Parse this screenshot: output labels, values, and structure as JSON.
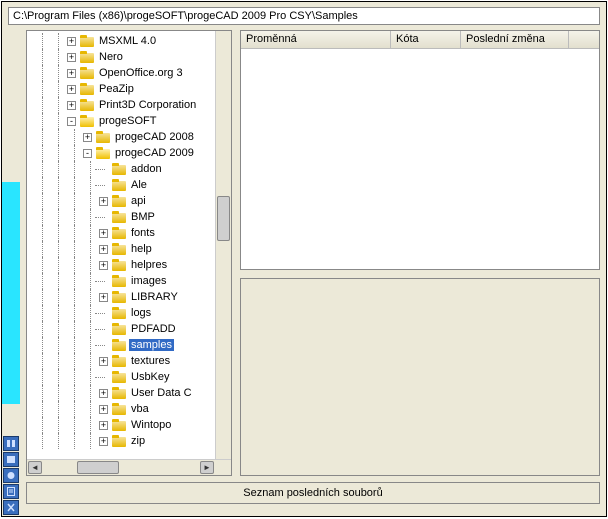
{
  "path": "C:\\Program Files (x86)\\progeSOFT\\progeCAD 2009 Pro CSY\\Samples",
  "tree": [
    {
      "depth": 6,
      "exp": "+",
      "label": "MSXML 4.0"
    },
    {
      "depth": 6,
      "exp": "+",
      "label": "Nero"
    },
    {
      "depth": 6,
      "exp": "+",
      "label": "OpenOffice.org 3"
    },
    {
      "depth": 6,
      "exp": "+",
      "label": "PeaZip"
    },
    {
      "depth": 6,
      "exp": "+",
      "label": "Print3D Corporation"
    },
    {
      "depth": 6,
      "exp": "-",
      "label": "progeSOFT",
      "open": true
    },
    {
      "depth": 7,
      "exp": "+",
      "label": "progeCAD 2008"
    },
    {
      "depth": 7,
      "exp": "-",
      "label": "progeCAD 2009",
      "open": true
    },
    {
      "depth": 8,
      "exp": "",
      "label": "addon"
    },
    {
      "depth": 8,
      "exp": "",
      "label": "Ale"
    },
    {
      "depth": 8,
      "exp": "+",
      "label": "api"
    },
    {
      "depth": 8,
      "exp": "",
      "label": "BMP"
    },
    {
      "depth": 8,
      "exp": "+",
      "label": "fonts"
    },
    {
      "depth": 8,
      "exp": "+",
      "label": "help"
    },
    {
      "depth": 8,
      "exp": "+",
      "label": "helpres"
    },
    {
      "depth": 8,
      "exp": "",
      "label": "images"
    },
    {
      "depth": 8,
      "exp": "+",
      "label": "LIBRARY"
    },
    {
      "depth": 8,
      "exp": "",
      "label": "logs"
    },
    {
      "depth": 8,
      "exp": "",
      "label": "PDFADD"
    },
    {
      "depth": 8,
      "exp": "",
      "label": "samples",
      "selected": true
    },
    {
      "depth": 8,
      "exp": "+",
      "label": "textures"
    },
    {
      "depth": 8,
      "exp": "",
      "label": "UsbKey"
    },
    {
      "depth": 8,
      "exp": "+",
      "label": "User Data C"
    },
    {
      "depth": 8,
      "exp": "+",
      "label": "vba"
    },
    {
      "depth": 8,
      "exp": "+",
      "label": "Wintopo"
    },
    {
      "depth": 8,
      "exp": "+",
      "label": "zip"
    }
  ],
  "columns": {
    "variable": "Proměnná",
    "bound": "Kóta",
    "last_modified": "Poslední změna"
  },
  "recent_button": "Seznam posledních souborů"
}
